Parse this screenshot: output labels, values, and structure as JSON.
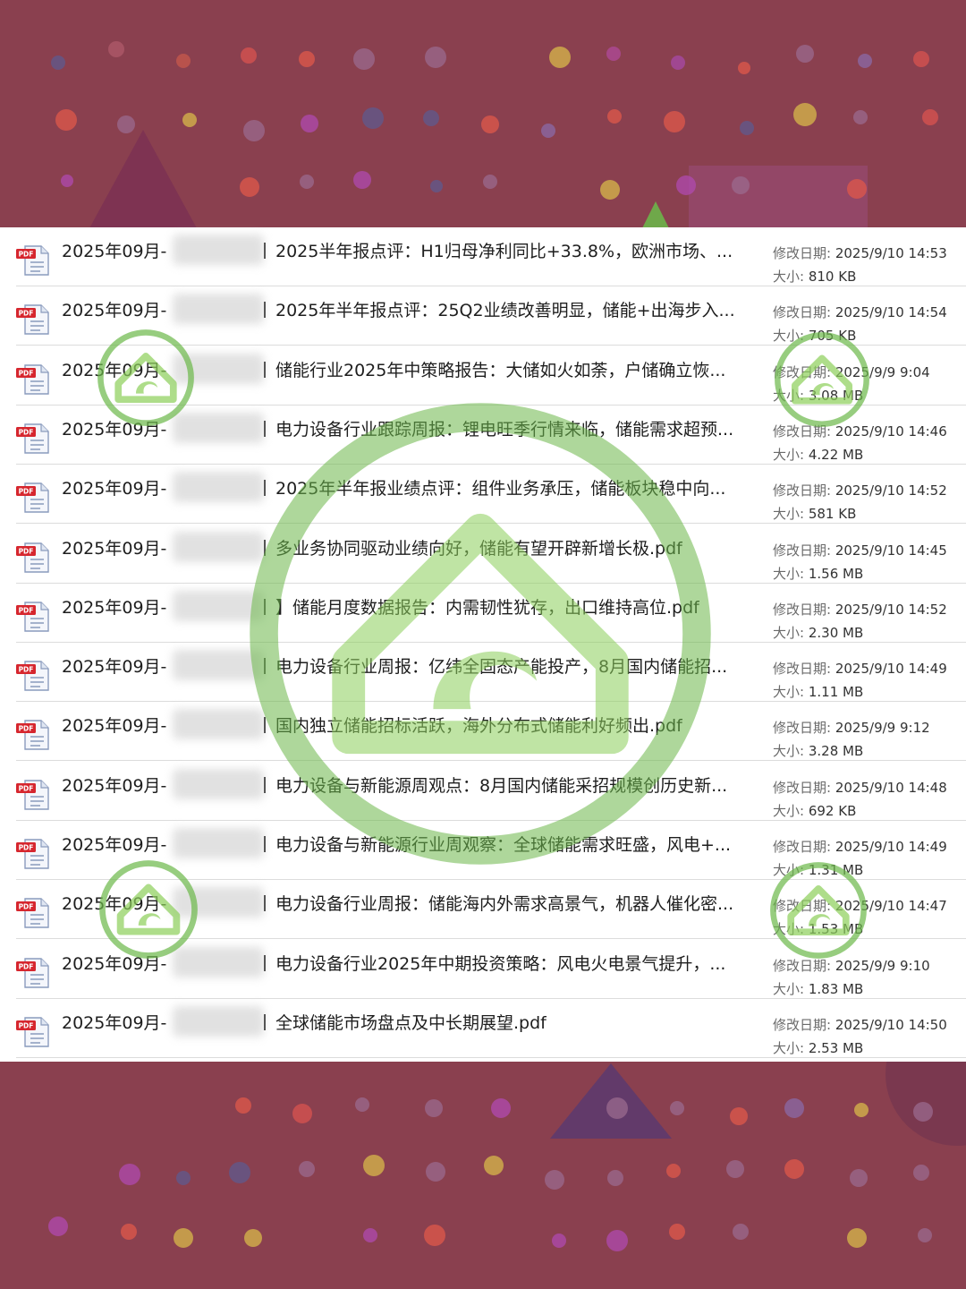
{
  "labels": {
    "modified": "修改日期:",
    "size": "大小:"
  },
  "files": [
    {
      "date": "2025年09月-",
      "name": "2025半年报点评：H1归母净利同比+33.8%，欧洲市场、...",
      "modified": "2025/9/10 14:53",
      "size": "810 KB"
    },
    {
      "date": "2025年09月-",
      "name": "2025年半年报点评：25Q2业绩改善明显，储能+出海步入...",
      "modified": "2025/9/10 14:54",
      "size": "705 KB"
    },
    {
      "date": "2025年09月-",
      "name": "储能行业2025年中策略报告：大储如火如荼，户储确立恢...",
      "modified": "2025/9/9 9:04",
      "size": "3.08 MB"
    },
    {
      "date": "2025年09月-",
      "name": "电力设备行业跟踪周报：锂电旺季行情来临，储能需求超预...",
      "modified": "2025/9/10 14:46",
      "size": "4.22 MB"
    },
    {
      "date": "2025年09月-",
      "name": "2025年半年报业绩点评：组件业务承压，储能板块稳中向...",
      "modified": "2025/9/10 14:52",
      "size": "581 KB"
    },
    {
      "date": "2025年09月-",
      "name": "多业务协同驱动业绩向好，储能有望开辟新增长极.pdf",
      "modified": "2025/9/10 14:45",
      "size": "1.56 MB"
    },
    {
      "date": "2025年09月-",
      "name": "】储能月度数据报告：内需韧性犹存，出口维持高位.pdf",
      "modified": "2025/9/10 14:52",
      "size": "2.30 MB"
    },
    {
      "date": "2025年09月-",
      "name": "电力设备行业周报：亿纬全固态产能投产，8月国内储能招...",
      "modified": "2025/9/10 14:49",
      "size": "1.11 MB"
    },
    {
      "date": "2025年09月-",
      "name": "国内独立储能招标活跃，海外分布式储能利好频出.pdf",
      "modified": "2025/9/9 9:12",
      "size": "3.28 MB"
    },
    {
      "date": "2025年09月-",
      "name": "电力设备与新能源周观点：8月国内储能采招规模创历史新...",
      "modified": "2025/9/10 14:48",
      "size": "692 KB"
    },
    {
      "date": "2025年09月-",
      "name": "电力设备与新能源行业周观察：全球储能需求旺盛，风电+...",
      "modified": "2025/9/10 14:49",
      "size": "1.31 MB"
    },
    {
      "date": "2025年09月-",
      "name": "电力设备行业周报：储能海内外需求高景气，机器人催化密...",
      "modified": "2025/9/10 14:47",
      "size": "1.53 MB"
    },
    {
      "date": "2025年09月-",
      "name": "电力设备行业2025年中期投资策略：风电火电景气提升，...",
      "modified": "2025/9/9 9:10",
      "size": "1.83 MB"
    },
    {
      "date": "2025年09月-",
      "name": "全球储能市场盘点及中长期展望.pdf",
      "modified": "2025/9/10 14:50",
      "size": "2.53 MB"
    }
  ],
  "icons": {
    "file": "pdf-file-icon",
    "watermark": "house-logo-watermark"
  },
  "colors": {
    "background": "#8a404f",
    "panel": "#ffffff",
    "watermark": "#5aa83c"
  }
}
